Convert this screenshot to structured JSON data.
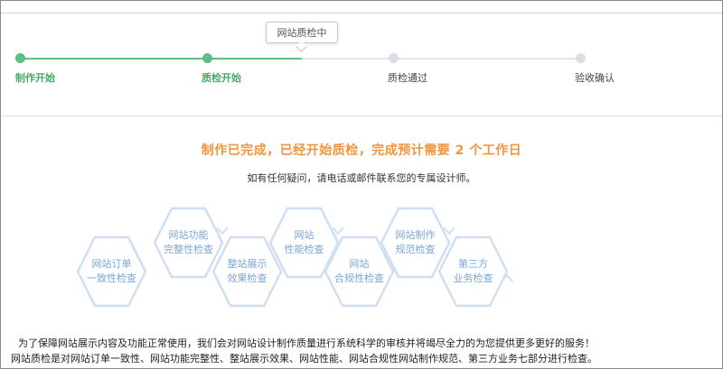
{
  "progress": {
    "steps": [
      {
        "label": "制作开始",
        "state": "done"
      },
      {
        "label": "质检开始",
        "state": "done"
      },
      {
        "label": "质检通过",
        "state": "todo"
      },
      {
        "label": "验收确认",
        "state": "todo"
      }
    ],
    "current_tooltip": "网站质检中"
  },
  "status": {
    "title": "制作已完成，已经开始质检，完成预计需要 2 个工作日",
    "subtitle": "如有任何疑问，请电话或邮件联系您的专属设计师。"
  },
  "flow": [
    {
      "lines": [
        "网站订单",
        "一致性检查"
      ]
    },
    {
      "lines": [
        "网站功能",
        "完整性检查"
      ]
    },
    {
      "lines": [
        "整站展示",
        "效果检查"
      ]
    },
    {
      "lines": [
        "网站",
        "性能检查"
      ]
    },
    {
      "lines": [
        "网站",
        "合规性检查"
      ]
    },
    {
      "lines": [
        "网站制作",
        "规范检查"
      ]
    },
    {
      "lines": [
        "第三方",
        "业务检查"
      ]
    }
  ],
  "footer": {
    "line1": "为了保障网站展示内容及功能正常使用，我们会对网站设计制作质量进行系统科学的审核并将竭尽全力的为您提供更多更好的服务！",
    "line2": "网站质检是对网站订单一致性、网站功能完整性、整站展示效果、网站性能、网站合规性网站制作规范、第三方业务七部分进行检查。"
  },
  "colors": {
    "done": "#5bbf86",
    "todo": "#dcdce6",
    "accent": "#f0953e",
    "flow_stroke": "#cfdff1",
    "flow_text": "#7aa6d8"
  }
}
